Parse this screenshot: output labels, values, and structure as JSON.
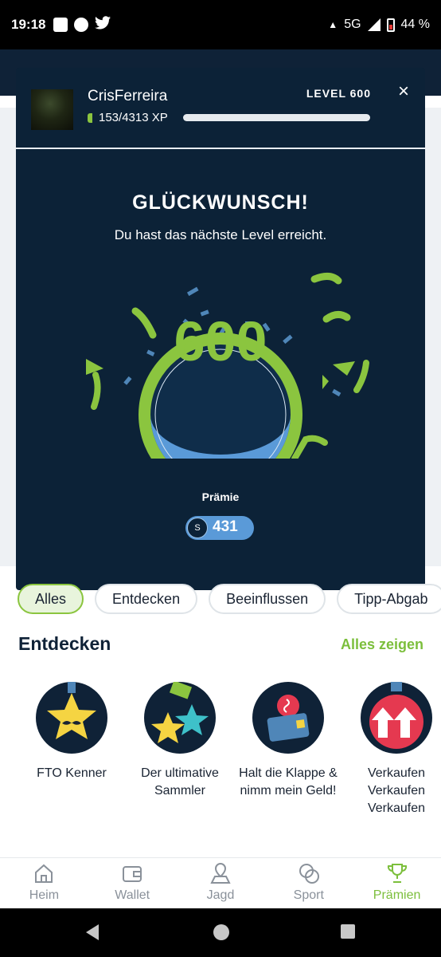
{
  "status_bar": {
    "time": "19:18",
    "network": "5G",
    "battery": "44 %"
  },
  "modal": {
    "username": "CrisFerreira",
    "xp": "153/4313 XP",
    "xp_progress": 0.035,
    "level_label": "LEVEL 600",
    "close": "×",
    "title": "GLÜCKWUNSCH!",
    "subtitle": "Du hast das nächste Level erreicht.",
    "level_number": "600",
    "reward_label": "Prämie",
    "reward_value": "431",
    "reward_icon": "coin-icon"
  },
  "filters": [
    {
      "label": "Alles",
      "active": true
    },
    {
      "label": "Entdecken",
      "active": false
    },
    {
      "label": "Beeinflussen",
      "active": false
    },
    {
      "label": "Tipp-Abgab",
      "active": false
    }
  ],
  "section": {
    "title": "Entdecken",
    "link": "Alles zeigen"
  },
  "achievements": [
    {
      "label": "FTO Kenner",
      "icon": "star-mustache-medal-icon"
    },
    {
      "label": "Der ultimative Sammler",
      "icon": "two-stars-medal-icon"
    },
    {
      "label": "Halt die Klappe & nimm mein Geld!",
      "icon": "wallet-medal-icon"
    },
    {
      "label": "Verkaufen Verkaufen Verkaufen",
      "icon": "arrows-medal-icon"
    }
  ],
  "bottom_nav": [
    {
      "label": "Heim",
      "icon": "home-icon",
      "active": false
    },
    {
      "label": "Wallet",
      "icon": "wallet-icon",
      "active": false
    },
    {
      "label": "Jagd",
      "icon": "map-pin-icon",
      "active": false
    },
    {
      "label": "Sport",
      "icon": "ball-icon",
      "active": false
    },
    {
      "label": "Prämien",
      "icon": "trophy-icon",
      "active": true
    }
  ],
  "colors": {
    "navy": "#0c2237",
    "green": "#8bc53f",
    "blue": "#5a9ad8"
  }
}
